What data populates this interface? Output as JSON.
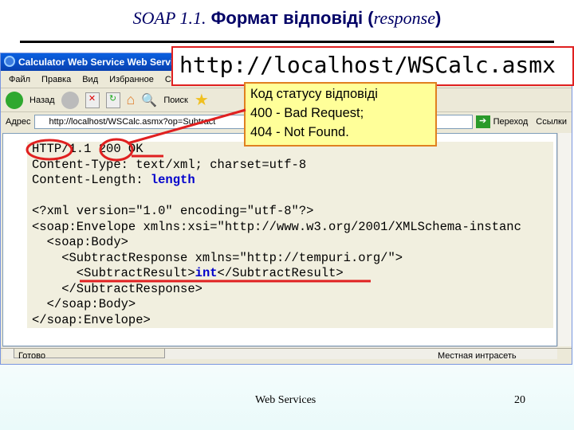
{
  "slide": {
    "title_part1": "SOAP 1.1.",
    "title_part2": " Формат відповіді (",
    "title_part3": "response",
    "title_part4": ")",
    "footer": "Web Services",
    "page": "20"
  },
  "browser": {
    "window_title": "Calculator Web Service Web Service -",
    "menu": [
      "Файл",
      "Правка",
      "Вид",
      "Избранное",
      "Сервис"
    ],
    "toolbar": {
      "back": "Назад",
      "search": "Поиск"
    },
    "address": {
      "label": "Адрес",
      "value": "http://localhost/WSCalc.asmx?op=Subtract",
      "go": "Переход",
      "links": "Ссылки"
    },
    "status": {
      "text": "Готово",
      "zone": "Местная интрасеть"
    },
    "code_lines": [
      "HTTP/1.1 200 OK",
      "Content-Type: text/xml; charset=utf-8",
      "Content-Length: ",
      "length",
      "",
      "<?xml version=\"1.0\" encoding=\"utf-8\"?>",
      "<soap:Envelope xmlns:xsi=\"http://www.w3.org/2001/XMLSchema-instanc",
      "  <soap:Body>",
      "    <SubtractResponse xmlns=\"http://tempuri.org/\">",
      "      <SubtractResult>",
      "int",
      "</SubtractResult>",
      "    </SubtractResponse>",
      "  </soap:Body>",
      "</soap:Envelope>"
    ]
  },
  "callouts": {
    "url": "http://localhost/WSCalc.asmx",
    "note_lines": [
      "Код статусу відповіді",
      "400 - Bad Request;",
      "404 - Not Found."
    ]
  },
  "colors": {
    "highlight": "#e02020",
    "note_bg": "#ffff99",
    "title": "#000066"
  }
}
